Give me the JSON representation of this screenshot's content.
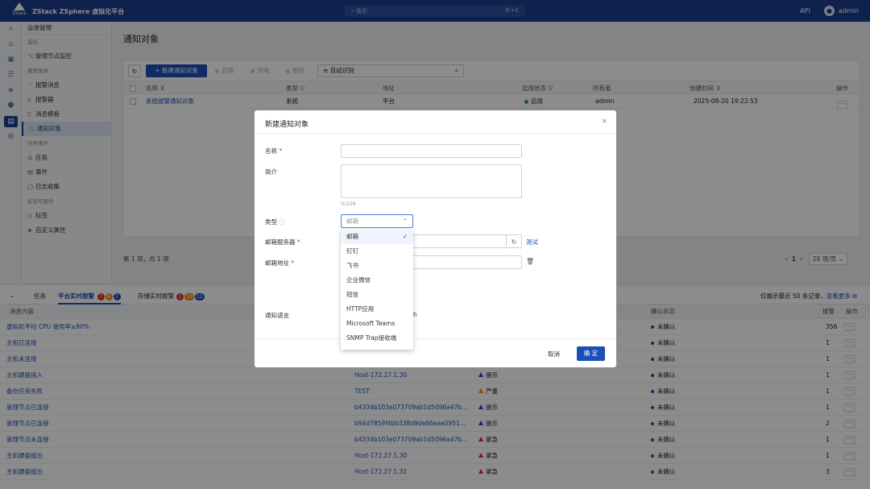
{
  "topbar": {
    "logo_text": "ZStack",
    "app_title": "ZStack ZSphere 虚拟化平台",
    "search_placeholder": "搜索",
    "search_shortcut": "⌘+K",
    "api": "API",
    "user": "admin"
  },
  "iconbar": {
    "collapse": "»"
  },
  "sidebar": {
    "header": "运维管理",
    "groups": [
      {
        "label": "监控",
        "items": [
          "管理节点监控"
        ]
      },
      {
        "label": "报警服务",
        "items": [
          "报警消息",
          "报警器",
          "消息模板",
          "通知对象"
        ]
      },
      {
        "label": "任务事件",
        "items": [
          "任务",
          "事件",
          "日志收集"
        ]
      },
      {
        "label": "标签与属性",
        "items": [
          "标签",
          "自定义属性"
        ]
      }
    ]
  },
  "main": {
    "title": "通知对象",
    "toolbar": {
      "new": "+ 新建通知对象",
      "enable": "启用",
      "disable": "停用",
      "delete": "删除",
      "filter": "自动识别"
    },
    "columns": [
      "名称",
      "类型",
      "地址",
      "启用状态",
      "所有者",
      "创建时间",
      "操作"
    ],
    "rows": [
      {
        "name": "系统报警通知对象",
        "type": "系统",
        "address": "平台",
        "status": "启用",
        "owner": "admin",
        "created": "2025-08-20 19:22:53"
      }
    ],
    "page_info": "第 1 项，共 1 项",
    "page_num": "1",
    "page_size": "20 项/页"
  },
  "bottom": {
    "tab_task": "任务",
    "tab_platform": "平台实时报警",
    "platform_badges": [
      "7",
      "8",
      "7"
    ],
    "tab_storage": "存储实时报警",
    "storage_badges": [
      "2",
      "10",
      "12"
    ],
    "note": "仅展示最近 50 条记录，",
    "more": "查看更多",
    "columns": [
      "消息内容",
      "确认状态",
      "报警",
      "操作"
    ],
    "rows": [
      {
        "msg": "虚拟机平均 CPU 使用率≥80%",
        "res": "",
        "level": "",
        "lvl": "",
        "confirm": "未确认",
        "count": "356"
      },
      {
        "msg": "主机已连接",
        "res": "",
        "level": "",
        "lvl": "",
        "confirm": "未确认",
        "count": "1"
      },
      {
        "msg": "主机未连接",
        "res": "",
        "level": "",
        "lvl": "",
        "confirm": "未确认",
        "count": "1"
      },
      {
        "msg": "主机硬盘插入",
        "res": "Host-172.27.1.30",
        "level": "提示",
        "lvl": "blue",
        "confirm": "未确认",
        "count": "1"
      },
      {
        "msg": "备份任务失败",
        "res": "TEST",
        "level": "严重",
        "lvl": "orange",
        "confirm": "未确认",
        "count": "1"
      },
      {
        "msg": "管理节点已连接",
        "res": "b4334b103e073709ab1d5096a47b...",
        "level": "提示",
        "lvl": "blue",
        "confirm": "未确认",
        "count": "1"
      },
      {
        "msg": "管理节点已连接",
        "res": "b94d7859f4bb338d9de86eae0951...",
        "level": "提示",
        "lvl": "blue",
        "confirm": "未确认",
        "count": "2"
      },
      {
        "msg": "管理节点未连接",
        "res": "b4334b103e073709ab1d5096a47b...",
        "level": "紧急",
        "lvl": "red",
        "confirm": "未确认",
        "count": "1"
      },
      {
        "msg": "主机硬盘拔出",
        "res": "Host-172.27.1.30",
        "level": "紧急",
        "lvl": "red",
        "confirm": "未确认",
        "count": "1"
      },
      {
        "msg": "主机硬盘拔出",
        "res": "Host-172.27.1.31",
        "level": "紧急",
        "lvl": "red",
        "confirm": "未确认",
        "count": "3"
      }
    ]
  },
  "modal": {
    "title": "新建通知对象",
    "name_label": "名称",
    "desc_label": "简介",
    "counter": "0/256",
    "type_label": "类型",
    "type_placeholder": "邮箱",
    "server_label": "邮箱服务器",
    "test": "测试",
    "addr_label": "邮箱地址",
    "lang_label": "通知语言",
    "lang_value_partial": "sh",
    "cancel": "取消",
    "ok": "确 定",
    "options": [
      "邮箱",
      "钉钉",
      "飞书",
      "企业微信",
      "短信",
      "HTTP应用",
      "Microsoft Teams",
      "SNMP Trap接收端"
    ]
  },
  "colors": {
    "brand": "#1d3f8c",
    "primary": "#1d4fb8",
    "danger": "#d93026",
    "warning": "#f08c1a",
    "success": "#2e9e44"
  }
}
